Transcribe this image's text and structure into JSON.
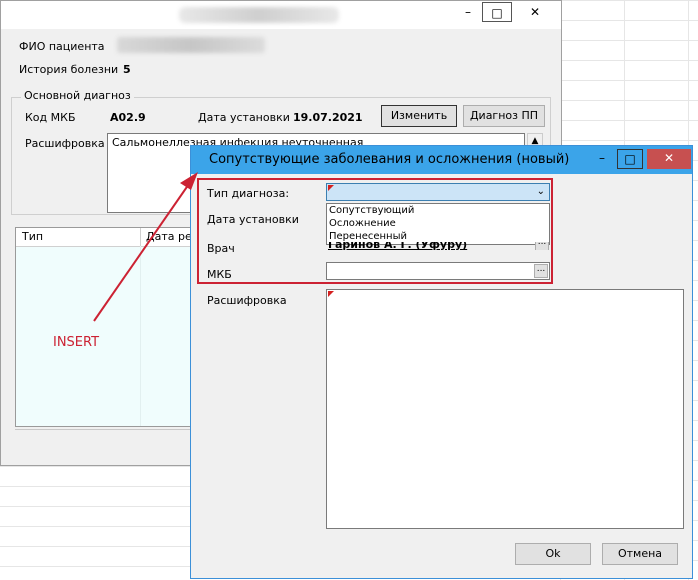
{
  "back_window": {
    "title_buttons": {
      "minimize": "–",
      "maximize": "□",
      "close": "✕"
    },
    "patient_label": "ФИО пациента",
    "history_label": "История болезни",
    "history_value": "5",
    "main_diagnosis": {
      "legend": "Основной диагноз",
      "mkb_label": "Код МКБ",
      "mkb_value": "A02.9",
      "date_label": "Дата установки",
      "date_value": "19.07.2021",
      "change_button": "Изменить",
      "pp_button": "Диагноз ПП",
      "decoding_label": "Расшифровка",
      "decoding_value": "Сальмонеллезная инфекция неуточненная"
    },
    "grid": {
      "columns": [
        "Тип",
        "Дата ре"
      ]
    }
  },
  "dialog": {
    "title": "Сопутствующие заболевания и осложнения (новый)",
    "title_buttons": {
      "minimize": "–",
      "maximize": "□",
      "close": "✕"
    },
    "type_label": "Тип диагноза:",
    "type_value": "",
    "type_options": [
      "Сопутствующий",
      "Осложнение",
      "Перенесенный"
    ],
    "date_label": "Дата установки",
    "doctor_label": "Врач",
    "doctor_value": "Гаринов А. Г. (Уфуру)",
    "mkb_label": "МКБ",
    "mkb_value": "",
    "decoding_label": "Расшифровка",
    "ok_button": "Ok",
    "cancel_button": "Отмена",
    "ellipsis": "..."
  },
  "annotation": {
    "label": "INSERT",
    "color": "#cc2233"
  },
  "colors": {
    "dialog_title_bg": "#3ba4e9",
    "close_bg": "#c75050",
    "combo_focus_bg": "#cce4f7"
  }
}
